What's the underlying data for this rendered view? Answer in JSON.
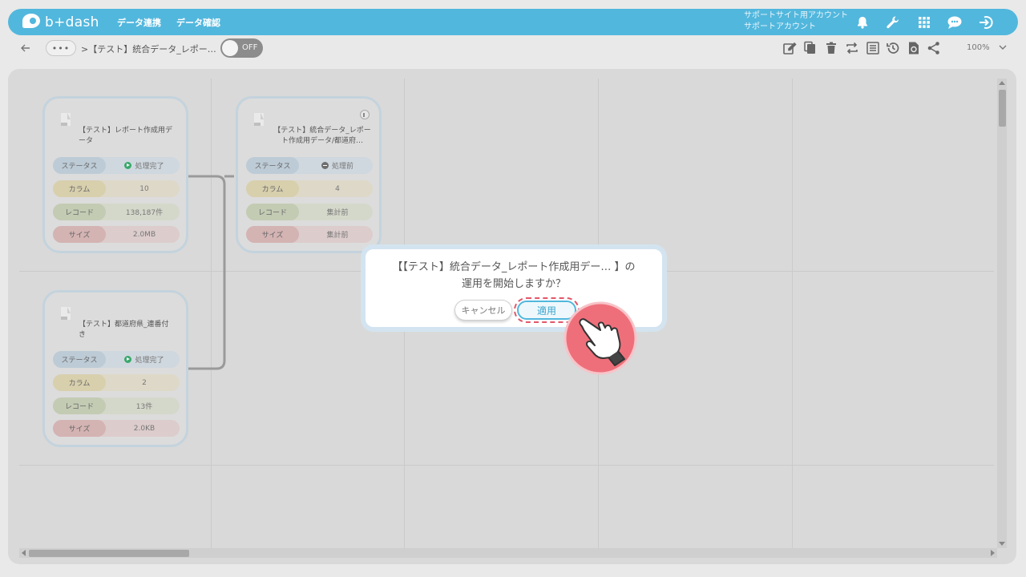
{
  "header": {
    "logo_text": "b+dash",
    "nav": [
      "データ連携",
      "データ確認"
    ],
    "account_line1": "サポートサイト用アカウント",
    "account_line2": "サポートアカウント",
    "icons": [
      "bell-icon",
      "wrench-icon",
      "apps-grid-icon",
      "chat-icon",
      "logout-icon"
    ]
  },
  "toolbar": {
    "dots": "•••",
    "breadcrumb": ">【テスト】統合データ_レポー…",
    "toggle_label": "OFF",
    "zoom": "100%",
    "icons": [
      "edit-icon",
      "copy-icon",
      "trash-icon",
      "swap-icon",
      "list-icon",
      "history-icon",
      "refresh-doc-icon",
      "share-icon"
    ]
  },
  "cards": [
    {
      "title": "【テスト】レポート作成用データ",
      "rows": [
        {
          "key": "ステータス",
          "value": "処理完了",
          "state": "done"
        },
        {
          "key": "カラム",
          "value": "10"
        },
        {
          "key": "レコード",
          "value": "138,187件"
        },
        {
          "key": "サイズ",
          "value": "2.0MB"
        }
      ]
    },
    {
      "title": "【テスト】都道府県_連番付き",
      "rows": [
        {
          "key": "ステータス",
          "value": "処理完了",
          "state": "done"
        },
        {
          "key": "カラム",
          "value": "2"
        },
        {
          "key": "レコード",
          "value": "13件"
        },
        {
          "key": "サイズ",
          "value": "2.0KB"
        }
      ]
    },
    {
      "title": "【テスト】統合データ_レポート作成用データ/都道府…",
      "rows": [
        {
          "key": "ステータス",
          "value": "処理前",
          "state": "pending"
        },
        {
          "key": "カラム",
          "value": "4"
        },
        {
          "key": "レコード",
          "value": "集計前"
        },
        {
          "key": "サイズ",
          "value": "集計前"
        }
      ]
    }
  ],
  "dialog": {
    "line1": "【【テスト】統合データ_レポート作成用デー… 】の",
    "line2": "運用を開始しますか？",
    "cancel": "キャンセル",
    "apply": "適用"
  },
  "colors": {
    "header_bg": "#52b7dd",
    "highlight_ring": "#e2586a",
    "hand_bg": "#ee6f7a",
    "status_done": "#3aa86b"
  }
}
